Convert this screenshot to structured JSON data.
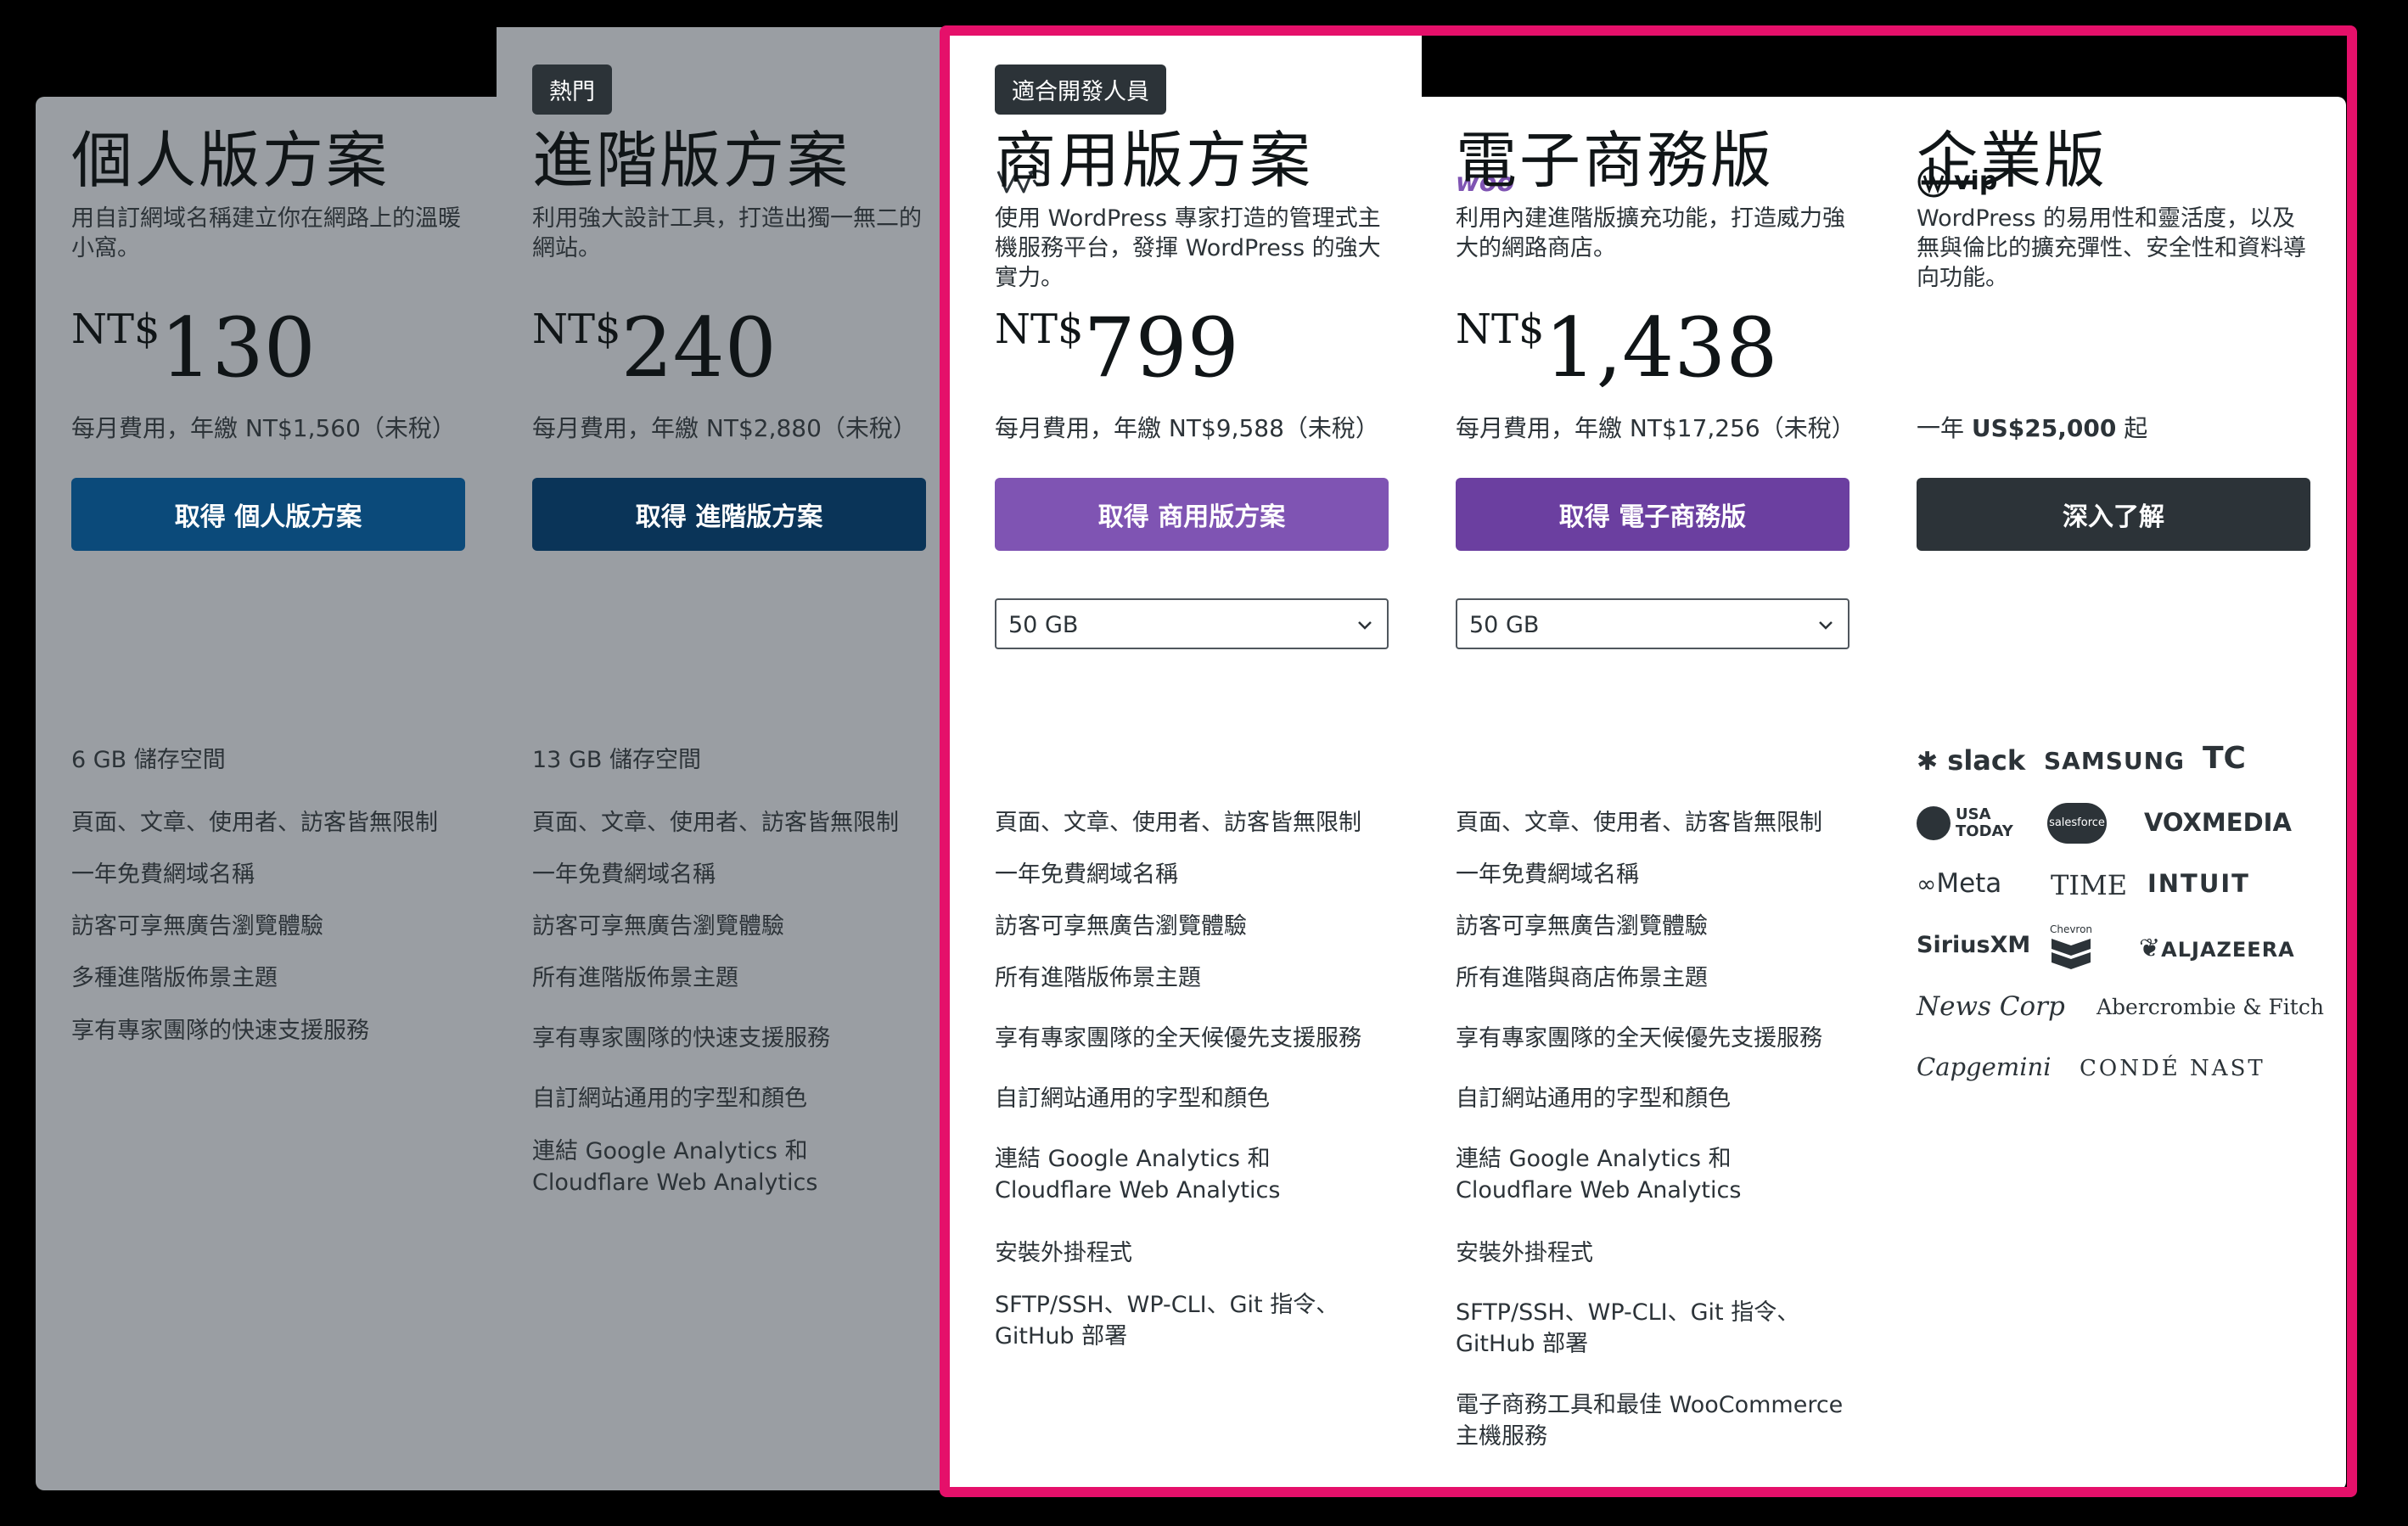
{
  "plans": [
    {
      "title": "個人版方案",
      "desc": "用自訂網域名稱建立你在網路上的溫暖小窩。",
      "currency": "NT$",
      "price": "130",
      "note": "每月費用，年繳 NT$1,560（未稅）",
      "cta": "取得 個人版方案",
      "features": [
        "6 GB 儲存空間",
        "頁面、文章、使用者、訪客皆無限制",
        "一年免費網域名稱",
        "訪客可享無廣告瀏覽體驗",
        "多種進階版佈景主題",
        "享有專家團隊的快速支援服務"
      ]
    },
    {
      "badge": "熱門",
      "title": "進階版方案",
      "desc": "利用強大設計工具，打造出獨一無二的網站。",
      "currency": "NT$",
      "price": "240",
      "note": "每月費用，年繳 NT$2,880（未稅）",
      "cta": "取得 進階版方案",
      "features": [
        "13 GB 儲存空間",
        "頁面、文章、使用者、訪客皆無限制",
        "一年免費網域名稱",
        "訪客可享無廣告瀏覽體驗",
        "所有進階版佈景主題",
        "享有專家團隊的快速支援服務",
        "自訂網站通用的字型和顏色",
        "連結 Google Analytics 和 Cloudflare Web Analytics"
      ]
    },
    {
      "badge": "適合開發人員",
      "logo": "WP",
      "title": "商用版方案",
      "desc": "使用 WordPress 專家打造的管理式主機服務平台，發揮 WordPress 的強大實力。",
      "currency": "NT$",
      "price": "799",
      "note": "每月費用，年繳 NT$9,588（未稅）",
      "cta": "取得 商用版方案",
      "storage": "50 GB",
      "features": [
        "頁面、文章、使用者、訪客皆無限制",
        "一年免費網域名稱",
        "訪客可享無廣告瀏覽體驗",
        "所有進階版佈景主題",
        "享有專家團隊的全天候優先支援服務",
        "自訂網站通用的字型和顏色",
        "連結 Google Analytics 和 Cloudflare Web Analytics",
        "安裝外掛程式",
        "SFTP/SSH、WP-CLI、Git 指令、GitHub 部署"
      ]
    },
    {
      "logo": "woo",
      "title": "電子商務版",
      "desc": "利用內建進階版擴充功能，打造威力強大的網路商店。",
      "currency": "NT$",
      "price": "1,438",
      "note": "每月費用，年繳 NT$17,256（未稅）",
      "cta": "取得 電子商務版",
      "storage": "50 GB",
      "features": [
        "頁面、文章、使用者、訪客皆無限制",
        "一年免費網域名稱",
        "訪客可享無廣告瀏覽體驗",
        "所有進階與商店佈景主題",
        "享有專家團隊的全天候優先支援服務",
        "自訂網站通用的字型和顏色",
        "連結 Google Analytics 和 Cloudflare Web Analytics",
        "安裝外掛程式",
        "SFTP/SSH、WP-CLI、Git 指令、GitHub 部署",
        "電子商務工具和最佳 WooCommerce 主機服務"
      ]
    },
    {
      "logo": "vip",
      "title": "企業版",
      "desc": "WordPress 的易用性和靈活度，以及無與倫比的擴充彈性、安全性和資料導向功能。",
      "note_prefix": "一年 ",
      "note_strong": "US$25,000",
      "note_suffix": " 起",
      "cta": "深入了解",
      "client_logos": [
        "slack",
        "SAMSUNG",
        "TC",
        "USA TODAY",
        "salesforce",
        "VOXMEDIA",
        "Meta",
        "TIME",
        "INTUIT",
        "SiriusXM",
        "Chevron",
        "ALJAZEERA",
        "News Corp",
        "Abercrombie & Fitch",
        "Capgemini",
        "CONDÉ NAST"
      ]
    }
  ],
  "colors": {
    "personal_cta": "#0b4a7a",
    "premium_cta": "#0a3458",
    "business_cta": "#7f54b3",
    "commerce_cta": "#6b3fa0",
    "enterprise_cta": "#2c3338",
    "highlight_border": "#e5106a",
    "woo_purple": "#7f54b3"
  }
}
